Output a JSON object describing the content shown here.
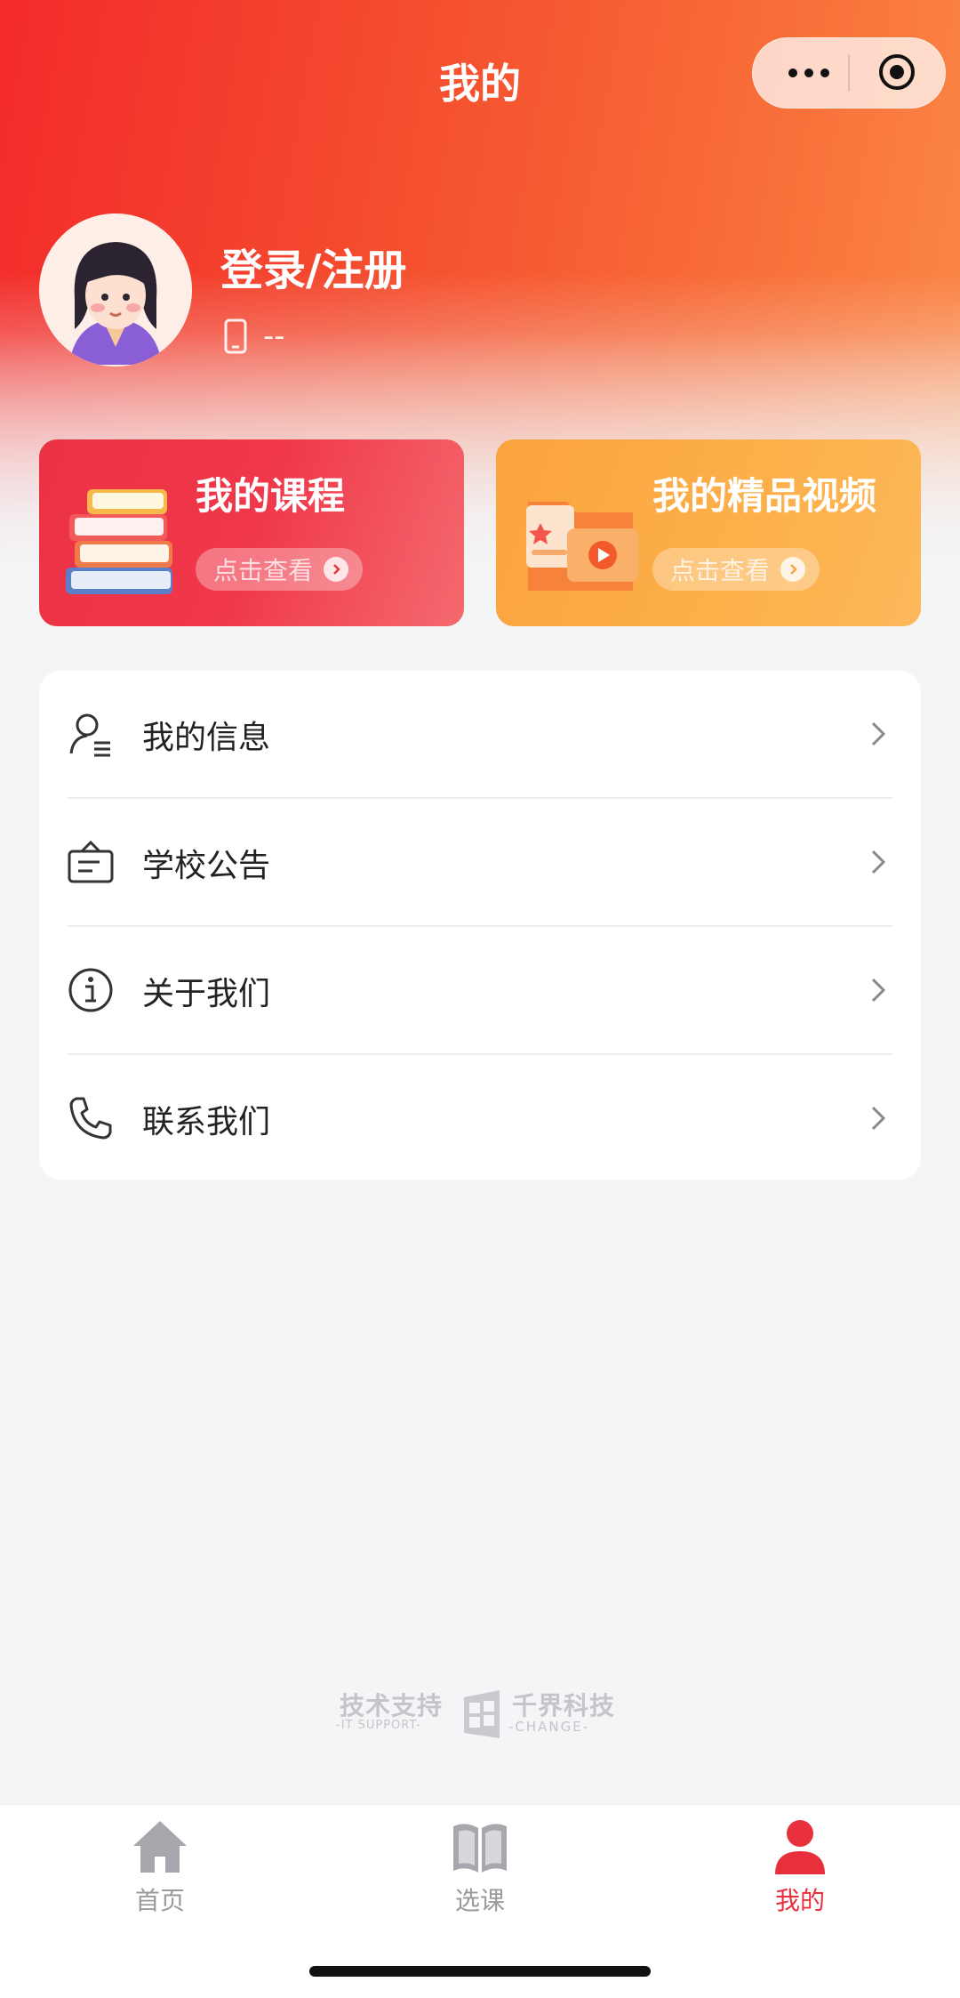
{
  "nav": {
    "title": "我的"
  },
  "capsule": {
    "more_icon": "more-dots-icon",
    "close_icon": "target-icon"
  },
  "profile": {
    "login_label": "登录/注册",
    "phone_icon": "phone-icon",
    "phone_value": "--"
  },
  "cards": [
    {
      "title": "我的课程",
      "button": "点击查看",
      "icon": "books-icon",
      "color": "#ea3244"
    },
    {
      "title": "我的精品视频",
      "button": "点击查看",
      "icon": "video-folder-icon",
      "color": "#fba43f"
    }
  ],
  "menu": [
    {
      "label": "我的信息",
      "icon": "user-info-icon"
    },
    {
      "label": "学校公告",
      "icon": "notice-board-icon"
    },
    {
      "label": "关于我们",
      "icon": "info-icon"
    },
    {
      "label": "联系我们",
      "icon": "phone-call-icon"
    }
  ],
  "support": {
    "tech": "技术支持",
    "tech_en": "IT SUPPORT",
    "company": "千界科技",
    "company_en": "CHANGE"
  },
  "tabs": [
    {
      "label": "首页",
      "icon": "home-icon",
      "active": false
    },
    {
      "label": "选课",
      "icon": "book-open-icon",
      "active": false
    },
    {
      "label": "我的",
      "icon": "user-icon",
      "active": true
    }
  ],
  "colors": {
    "accent": "#e8303c",
    "inactive": "#9a9a9a"
  }
}
